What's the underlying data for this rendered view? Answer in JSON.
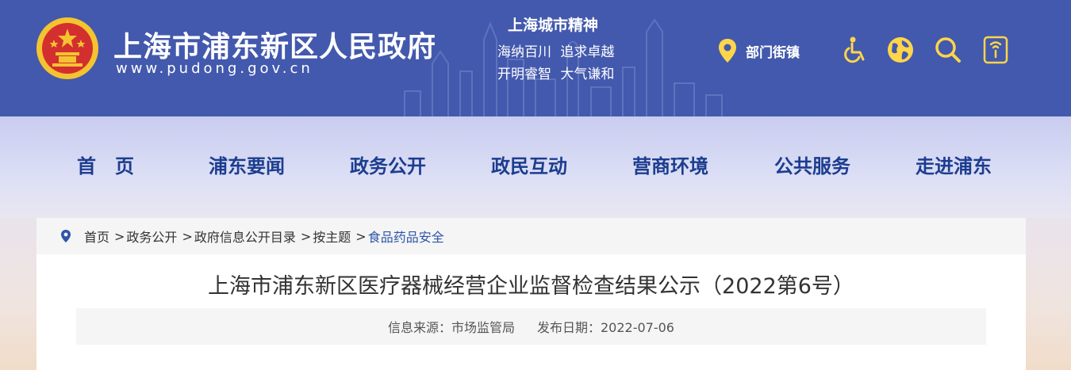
{
  "header": {
    "site_title": "上海市浦东新区人民政府",
    "site_url": "www.pudong.gov.cn",
    "spirit_title": "上海城市精神",
    "spirit_line1": "海纳百川 追求卓越",
    "spirit_line2": "开明睿智 大气谦和",
    "dept_label": "部门街镇",
    "icons": [
      "location-pin-icon",
      "accessibility-icon",
      "globe-icon",
      "search-icon",
      "mobile-icon"
    ],
    "accent_color": "#ffd54a",
    "bg_color": "#4359ad"
  },
  "nav": {
    "items": [
      "首　页",
      "浦东要闻",
      "政务公开",
      "政民互动",
      "营商环境",
      "公共服务",
      "走进浦东"
    ],
    "text_color": "#1c3d8f"
  },
  "breadcrumb": {
    "items": [
      "首页",
      "政务公开",
      "政府信息公开目录",
      "按主题",
      "食品药品安全"
    ],
    "separator": ">"
  },
  "article": {
    "title": "上海市浦东新区医疗器械经营企业监督检查结果公示（2022第6号）",
    "source": "信息来源：市场监管局",
    "date": "发布日期：2022-07-06"
  }
}
